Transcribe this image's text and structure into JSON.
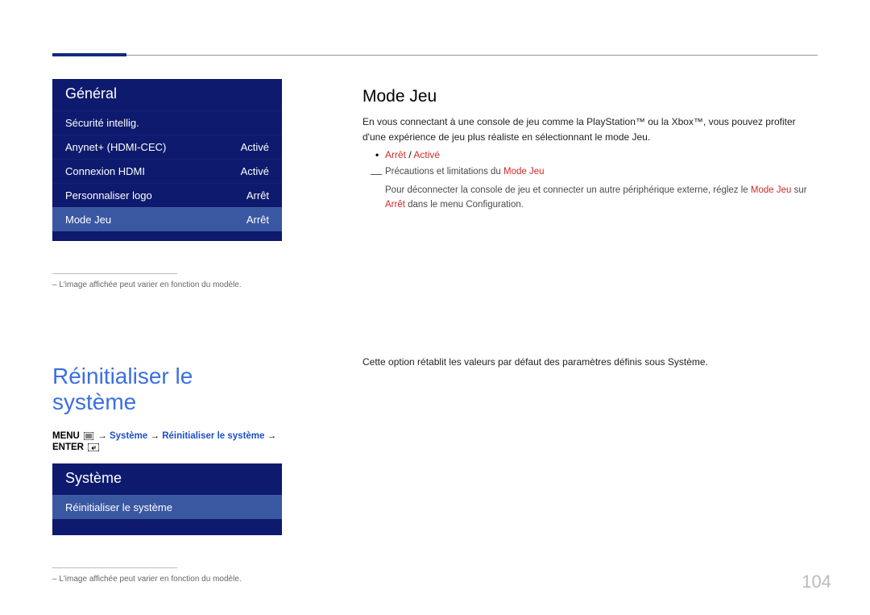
{
  "page_number": "104",
  "menu1": {
    "title": "Général",
    "rows": [
      {
        "label": "Sécurité intellig.",
        "value": ""
      },
      {
        "label": "Anynet+ (HDMI-CEC)",
        "value": "Activé"
      },
      {
        "label": "Connexion HDMI",
        "value": "Activé"
      },
      {
        "label": "Personnaliser logo",
        "value": "Arrêt"
      },
      {
        "label": "Mode Jeu",
        "value": "Arrêt"
      }
    ]
  },
  "footnote": "– L'image affichée peut varier en fonction du modèle.",
  "section_heading": "Réinitialiser le système",
  "menu_path": {
    "prefix": "MENU",
    "arrow": "→",
    "part1": "Système",
    "part2": "Réinitialiser le système",
    "suffix": "ENTER"
  },
  "menu2": {
    "title": "Système",
    "rows": [
      {
        "label": "Réinitialiser le système",
        "value": ""
      }
    ]
  },
  "right": {
    "heading": "Mode Jeu",
    "intro": "En vous connectant à une console de jeu comme la PlayStation™ ou la Xbox™, vous pouvez profiter d'une expérience de jeu plus réaliste en sélectionnant le mode Jeu.",
    "bullet_off": "Arrêt",
    "bullet_sep": " / ",
    "bullet_on": "Activé",
    "note_title_pre": "Précautions et limitations du ",
    "note_title_red": "Mode Jeu",
    "note_body_pre": "Pour déconnecter la console de jeu et connecter un autre périphérique externe, réglez le ",
    "note_body_red1": "Mode Jeu",
    "note_body_mid": " sur ",
    "note_body_red2": "Arrêt",
    "note_body_post": " dans le menu Configuration.",
    "lower_body": "Cette option rétablit les valeurs par défaut des paramètres définis sous Système."
  }
}
